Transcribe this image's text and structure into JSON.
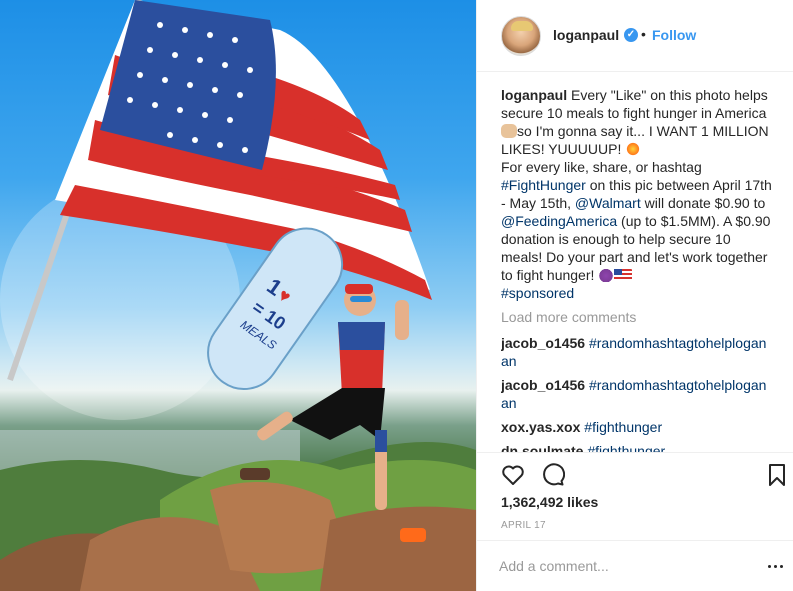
{
  "post": {
    "photo_icon": "post-photo",
    "flag_icon": "american-flag",
    "longboard_icon": "longboard",
    "longboard_text": "1♥ = 10 MEALS"
  },
  "header": {
    "avatar_icon": "user-avatar",
    "username": "loganpaul",
    "verified_icon": "verified-badge-icon",
    "separator": "•",
    "follow_label": "Follow"
  },
  "caption": {
    "username": "loganpaul",
    "part1": " Every \"Like\" on this photo helps secure 10 meals to fight hunger in America ",
    "emoji1": "fist-icon",
    "part2": "so I'm gonna say it... I WANT 1 MILLION LIKES! YUUUUUP! ",
    "emoji2": "collision-icon",
    "part3": "For every like, share, or hashtag ",
    "hashtag1": "#FightHunger",
    "part4": " on this pic between April 17th - May 15th, ",
    "mention1": "@Walmart",
    "part5": " will donate $0.90 to ",
    "mention2": "@FeedingAmerica",
    "part6": " (up to $1.5MM). A $0.90 donation is enough to help secure 10 meals! Do your part and let's work together to fight hunger! ",
    "emoji3": "devil-icon",
    "emoji4": "us-flag-icon",
    "hashtag2": "#sponsored"
  },
  "load_more_label": "Load more comments",
  "comments": [
    {
      "user": "jacob_o1456",
      "text": "#randomhashtagtohelploganan"
    },
    {
      "user": "jacob_o1456",
      "text": "#randomhashtagtohelploganan"
    },
    {
      "user": "xox.yas.xox",
      "text": "#fighthunger"
    },
    {
      "user": "dn.soulmate",
      "text": "#fighthunger"
    }
  ],
  "actions": {
    "like_icon": "heart-icon",
    "comment_icon": "comment-icon",
    "save_icon": "bookmark-icon"
  },
  "likes_text": "1,362,492 likes",
  "date_text": "APRIL 17",
  "add_comment": {
    "placeholder": "Add a comment...",
    "more_icon": "more-options-icon"
  },
  "colors": {
    "link": "#003569",
    "follow": "#3897f0",
    "muted": "#999999",
    "text": "#262626"
  }
}
